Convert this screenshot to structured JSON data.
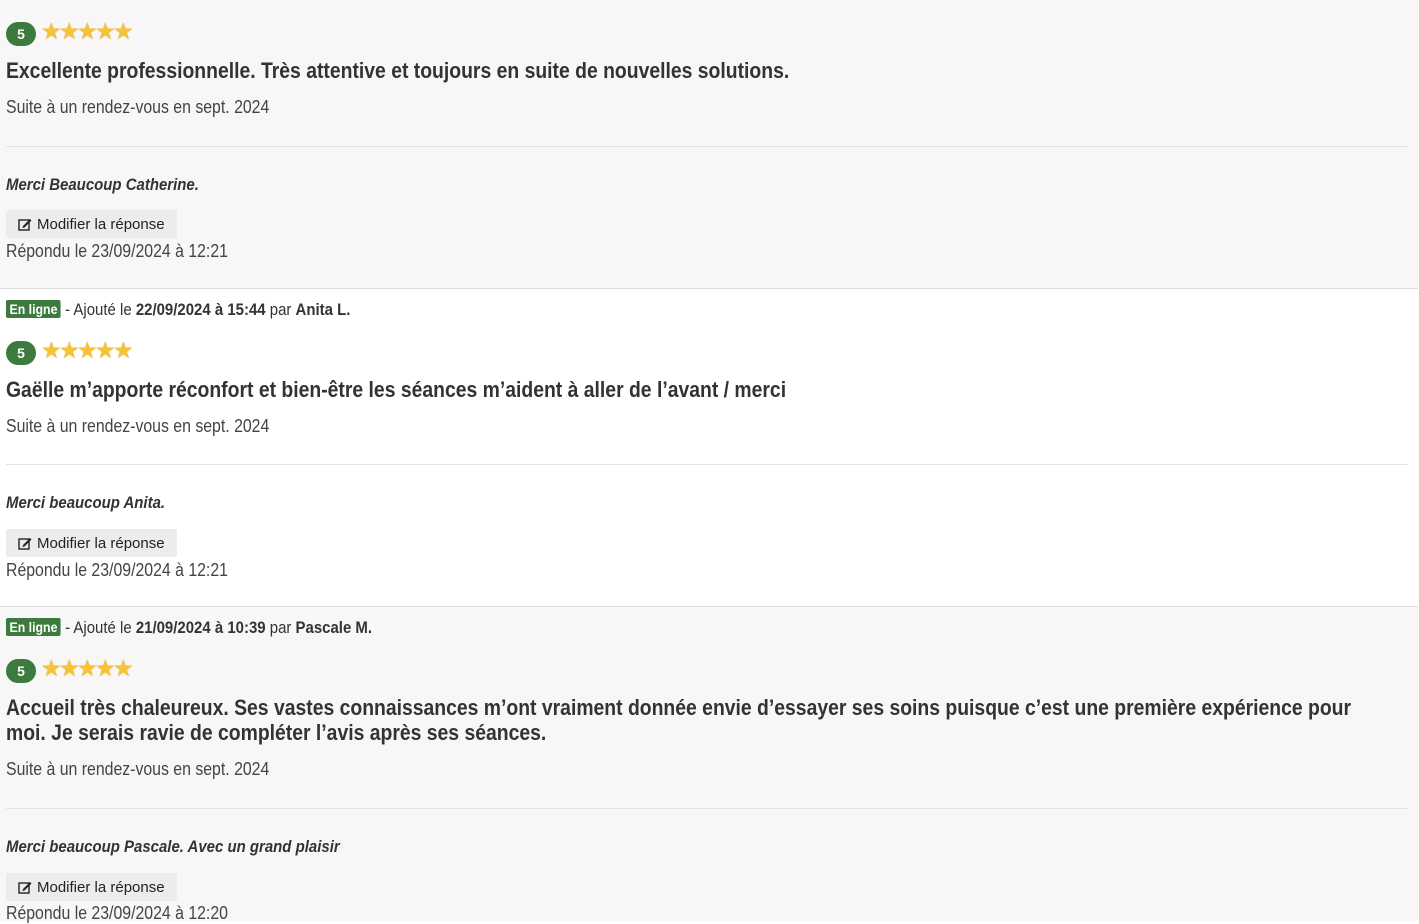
{
  "colors": {
    "accent_green": "#3d7a3d",
    "star_gold": "#f6c23a"
  },
  "reviews": [
    {
      "status_badge": "",
      "meta_prefix": "",
      "date": "",
      "by": "",
      "author": "",
      "score": "5",
      "stars": 5,
      "comment": "Excellente professionnelle. Très attentive et toujours en suite de nouvelles solutions.",
      "visit": "Suite à un rendez-vous en sept. 2024",
      "reply": "Merci Beaucoup Catherine.",
      "edit_label": "Modifier la réponse",
      "replied": "Répondu le 23/09/2024 à 12:21"
    },
    {
      "status_badge": "En ligne",
      "meta_prefix": " - Ajouté le ",
      "date": "22/09/2024 à 15:44",
      "by": " par ",
      "author": "Anita L.",
      "score": "5",
      "stars": 5,
      "comment": "Gaëlle m’apporte réconfort et bien-être les séances m’aident à aller de l’avant / merci",
      "visit": "Suite à un rendez-vous en sept. 2024",
      "reply": "Merci beaucoup Anita.",
      "edit_label": "Modifier la réponse",
      "replied": "Répondu le 23/09/2024 à 12:21"
    },
    {
      "status_badge": "En ligne",
      "meta_prefix": " - Ajouté le ",
      "date": "21/09/2024 à 10:39",
      "by": " par ",
      "author": "Pascale M.",
      "score": "5",
      "stars": 5,
      "comment": "Accueil très chaleureux. Ses vastes connaissances m’ont vraiment donnée envie d’essayer ses soins puisque c’est une première expérience pour moi. Je serais ravie de compléter l’avis après ses séances.",
      "visit": "Suite à un rendez-vous en sept. 2024",
      "reply": "Merci beaucoup Pascale. Avec un grand plaisir",
      "edit_label": "Modifier la réponse",
      "replied": "Répondu le 23/09/2024 à 12:20"
    }
  ]
}
